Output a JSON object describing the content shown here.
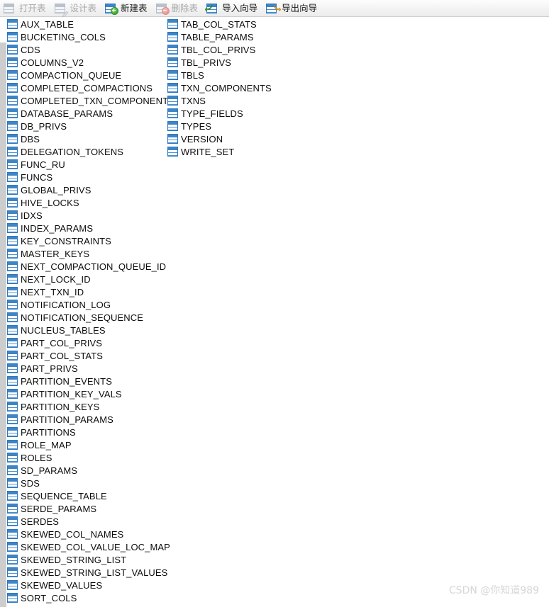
{
  "toolbar": {
    "buttons": [
      {
        "label": "打开表",
        "icon": "open-table-icon",
        "enabled": false,
        "badge": "none"
      },
      {
        "label": "设计表",
        "icon": "design-table-icon",
        "enabled": false,
        "badge": "pencil"
      },
      {
        "label": "新建表",
        "icon": "new-table-icon",
        "enabled": true,
        "badge": "plus"
      },
      {
        "label": "删除表",
        "icon": "delete-table-icon",
        "enabled": false,
        "badge": "minus"
      },
      {
        "label": "导入向导",
        "icon": "import-wizard-icon",
        "enabled": true,
        "badge": "arrow-green"
      },
      {
        "label": "导出向导",
        "icon": "export-wizard-icon",
        "enabled": true,
        "badge": "arrow-orange"
      }
    ]
  },
  "table_list": {
    "item_icon": "table-grid-icon",
    "column_1": [
      "AUX_TABLE",
      "BUCKETING_COLS",
      "CDS",
      "COLUMNS_V2",
      "COMPACTION_QUEUE",
      "COMPLETED_COMPACTIONS",
      "COMPLETED_TXN_COMPONENTS",
      "DATABASE_PARAMS",
      "DB_PRIVS",
      "DBS",
      "DELEGATION_TOKENS",
      "FUNC_RU",
      "FUNCS",
      "GLOBAL_PRIVS",
      "HIVE_LOCKS",
      "IDXS",
      "INDEX_PARAMS",
      "KEY_CONSTRAINTS",
      "MASTER_KEYS",
      "NEXT_COMPACTION_QUEUE_ID",
      "NEXT_LOCK_ID",
      "NEXT_TXN_ID",
      "NOTIFICATION_LOG",
      "NOTIFICATION_SEQUENCE",
      "NUCLEUS_TABLES",
      "PART_COL_PRIVS",
      "PART_COL_STATS",
      "PART_PRIVS",
      "PARTITION_EVENTS",
      "PARTITION_KEY_VALS",
      "PARTITION_KEYS",
      "PARTITION_PARAMS",
      "PARTITIONS",
      "ROLE_MAP",
      "ROLES",
      "SD_PARAMS",
      "SDS",
      "SEQUENCE_TABLE",
      "SERDE_PARAMS",
      "SERDES",
      "SKEWED_COL_NAMES",
      "SKEWED_COL_VALUE_LOC_MAP",
      "SKEWED_STRING_LIST",
      "SKEWED_STRING_LIST_VALUES",
      "SKEWED_VALUES",
      "SORT_COLS"
    ],
    "column_2": [
      "TAB_COL_STATS",
      "TABLE_PARAMS",
      "TBL_COL_PRIVS",
      "TBL_PRIVS",
      "TBLS",
      "TXN_COMPONENTS",
      "TXNS",
      "TYPE_FIELDS",
      "TYPES",
      "VERSION",
      "WRITE_SET"
    ]
  },
  "watermark": {
    "text": "CSDN @你知道989"
  },
  "colors": {
    "icon_blue": "#3d85c6",
    "icon_blue_border": "#2e78c0",
    "icon_disabled": "#b9c2cc",
    "toolbar_bg": "#f1f1f1",
    "scrollbar": "#cdcdcd",
    "text": "#0c0c0c",
    "watermark": "#d6d6d6"
  }
}
